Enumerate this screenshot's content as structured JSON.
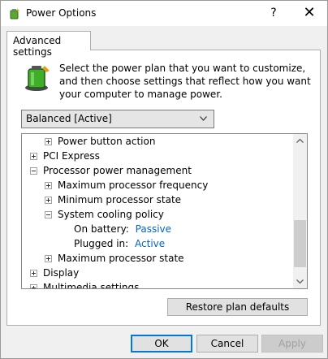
{
  "window": {
    "title": "Power Options",
    "help_label": "?",
    "close_label": "✕"
  },
  "tab": {
    "label": "Advanced settings"
  },
  "description": "Select the power plan that you want to customize, and then choose settings that reflect how you want your computer to manage power.",
  "plan_select": {
    "value": "Balanced [Active]"
  },
  "tree": [
    {
      "label": "Power button action",
      "state": "collapsed"
    },
    {
      "label": "PCI Express",
      "state": "collapsed"
    },
    {
      "label": "Processor power management",
      "state": "expanded"
    },
    {
      "label": "Maximum processor frequency",
      "state": "collapsed"
    },
    {
      "label": "Minimum processor state",
      "state": "collapsed"
    },
    {
      "label": "System cooling policy",
      "state": "expanded"
    },
    {
      "label": "On battery:",
      "value": "Passive"
    },
    {
      "label": "Plugged in:",
      "value": "Active"
    },
    {
      "label": "Maximum processor state",
      "state": "collapsed"
    },
    {
      "label": "Display",
      "state": "collapsed"
    },
    {
      "label": "Multimedia settings",
      "state": "collapsed"
    }
  ],
  "buttons": {
    "restore": "Restore plan defaults",
    "ok": "OK",
    "cancel": "Cancel",
    "apply": "Apply"
  },
  "colors": {
    "link": "#0066cc",
    "accent": "#0078d7"
  }
}
